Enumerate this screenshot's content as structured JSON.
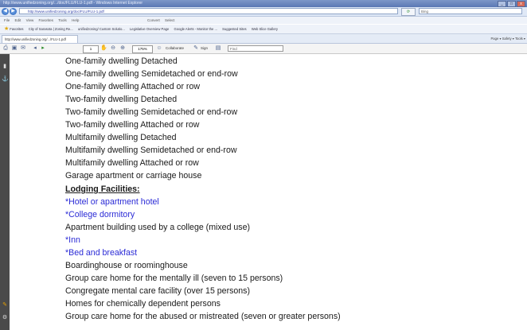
{
  "browser": {
    "title": "http://www.unifiedzoning.org/.../doc/FLU/FLU-1.pdf - Windows Internet Explorer",
    "url": "http://www.unifiedzoning.org/doc/FLU/FLU-1.pdf",
    "search_placeholder": "Bing",
    "menu": [
      "File",
      "Edit",
      "View",
      "Favorites",
      "Tools",
      "Help"
    ],
    "convert_label": "Convert",
    "select_label": "Select",
    "favorites_label": "Favorites",
    "favorites": [
      "City of Sarasota | Zoning Re...",
      "unifiedzoning/ Custom Solutio...",
      "Legislative Overview Page",
      "Google Alerts - Monitor the ...",
      "Suggested Sites",
      "Web Slice Gallery"
    ],
    "tab_label": "http://www.unifiedzoning.org/.../FLU-1.pdf",
    "tab_tools": "Page ▾  Safety ▾  Tools ▾"
  },
  "pdf_toolbar": {
    "page": "1",
    "zoom": "175%",
    "collaborate": "Collaborate",
    "sign": "Sign",
    "find_placeholder": "Find"
  },
  "document": {
    "lines": [
      {
        "text": "One-family dwelling  Detached",
        "style": "normal"
      },
      {
        "text": "One-family dwelling  Semidetached or end-row",
        "style": "normal"
      },
      {
        "text": "One-family dwelling  Attached or row",
        "style": "normal"
      },
      {
        "text": "Two-family dwelling Detached",
        "style": "normal"
      },
      {
        "text": "Two-family dwelling Semidetached or end-row",
        "style": "normal"
      },
      {
        "text": "Two-family dwelling  Attached or row",
        "style": "normal"
      },
      {
        "text": "Multifamily dwelling  Detached",
        "style": "normal"
      },
      {
        "text": "Multifamily dwelling  Semidetached or end-row",
        "style": "normal"
      },
      {
        "text": "Multifamily dwelling  Attached or row",
        "style": "normal"
      },
      {
        "text": "Garage apartment or carriage house",
        "style": "normal"
      },
      {
        "text": "Lodging Facilities:",
        "style": "heading"
      },
      {
        "text": "*Hotel or apartment hotel",
        "style": "blue"
      },
      {
        "text": "*College dormitory",
        "style": "blue"
      },
      {
        "text": "Apartment building used by a college (mixed use)",
        "style": "normal"
      },
      {
        "text": "*Inn",
        "style": "blue"
      },
      {
        "text": "*Bed and breakfast",
        "style": "blue"
      },
      {
        "text": "Boardinghouse or roominghouse",
        "style": "normal"
      },
      {
        "text": "Group care home for the mentally ill (seven to 15 persons)",
        "style": "normal"
      },
      {
        "text": "Congregate mental care facility (over 15 persons)",
        "style": "normal"
      },
      {
        "text": "Homes for chemically dependent persons",
        "style": "normal"
      },
      {
        "text": "Group care home for the abused or mistreated (seven or greater persons)",
        "style": "normal"
      }
    ]
  },
  "colors": {
    "link_blue": "#2b2bd6",
    "text": "#1a1a1a",
    "side_panel": "#4a4a4a"
  },
  "icons": [
    "back-icon",
    "forward-icon",
    "refresh-icon",
    "star-icon",
    "print-icon",
    "save-icon",
    "zoom-in-icon",
    "zoom-out-icon",
    "pages-panel-icon",
    "attachments-icon"
  ]
}
